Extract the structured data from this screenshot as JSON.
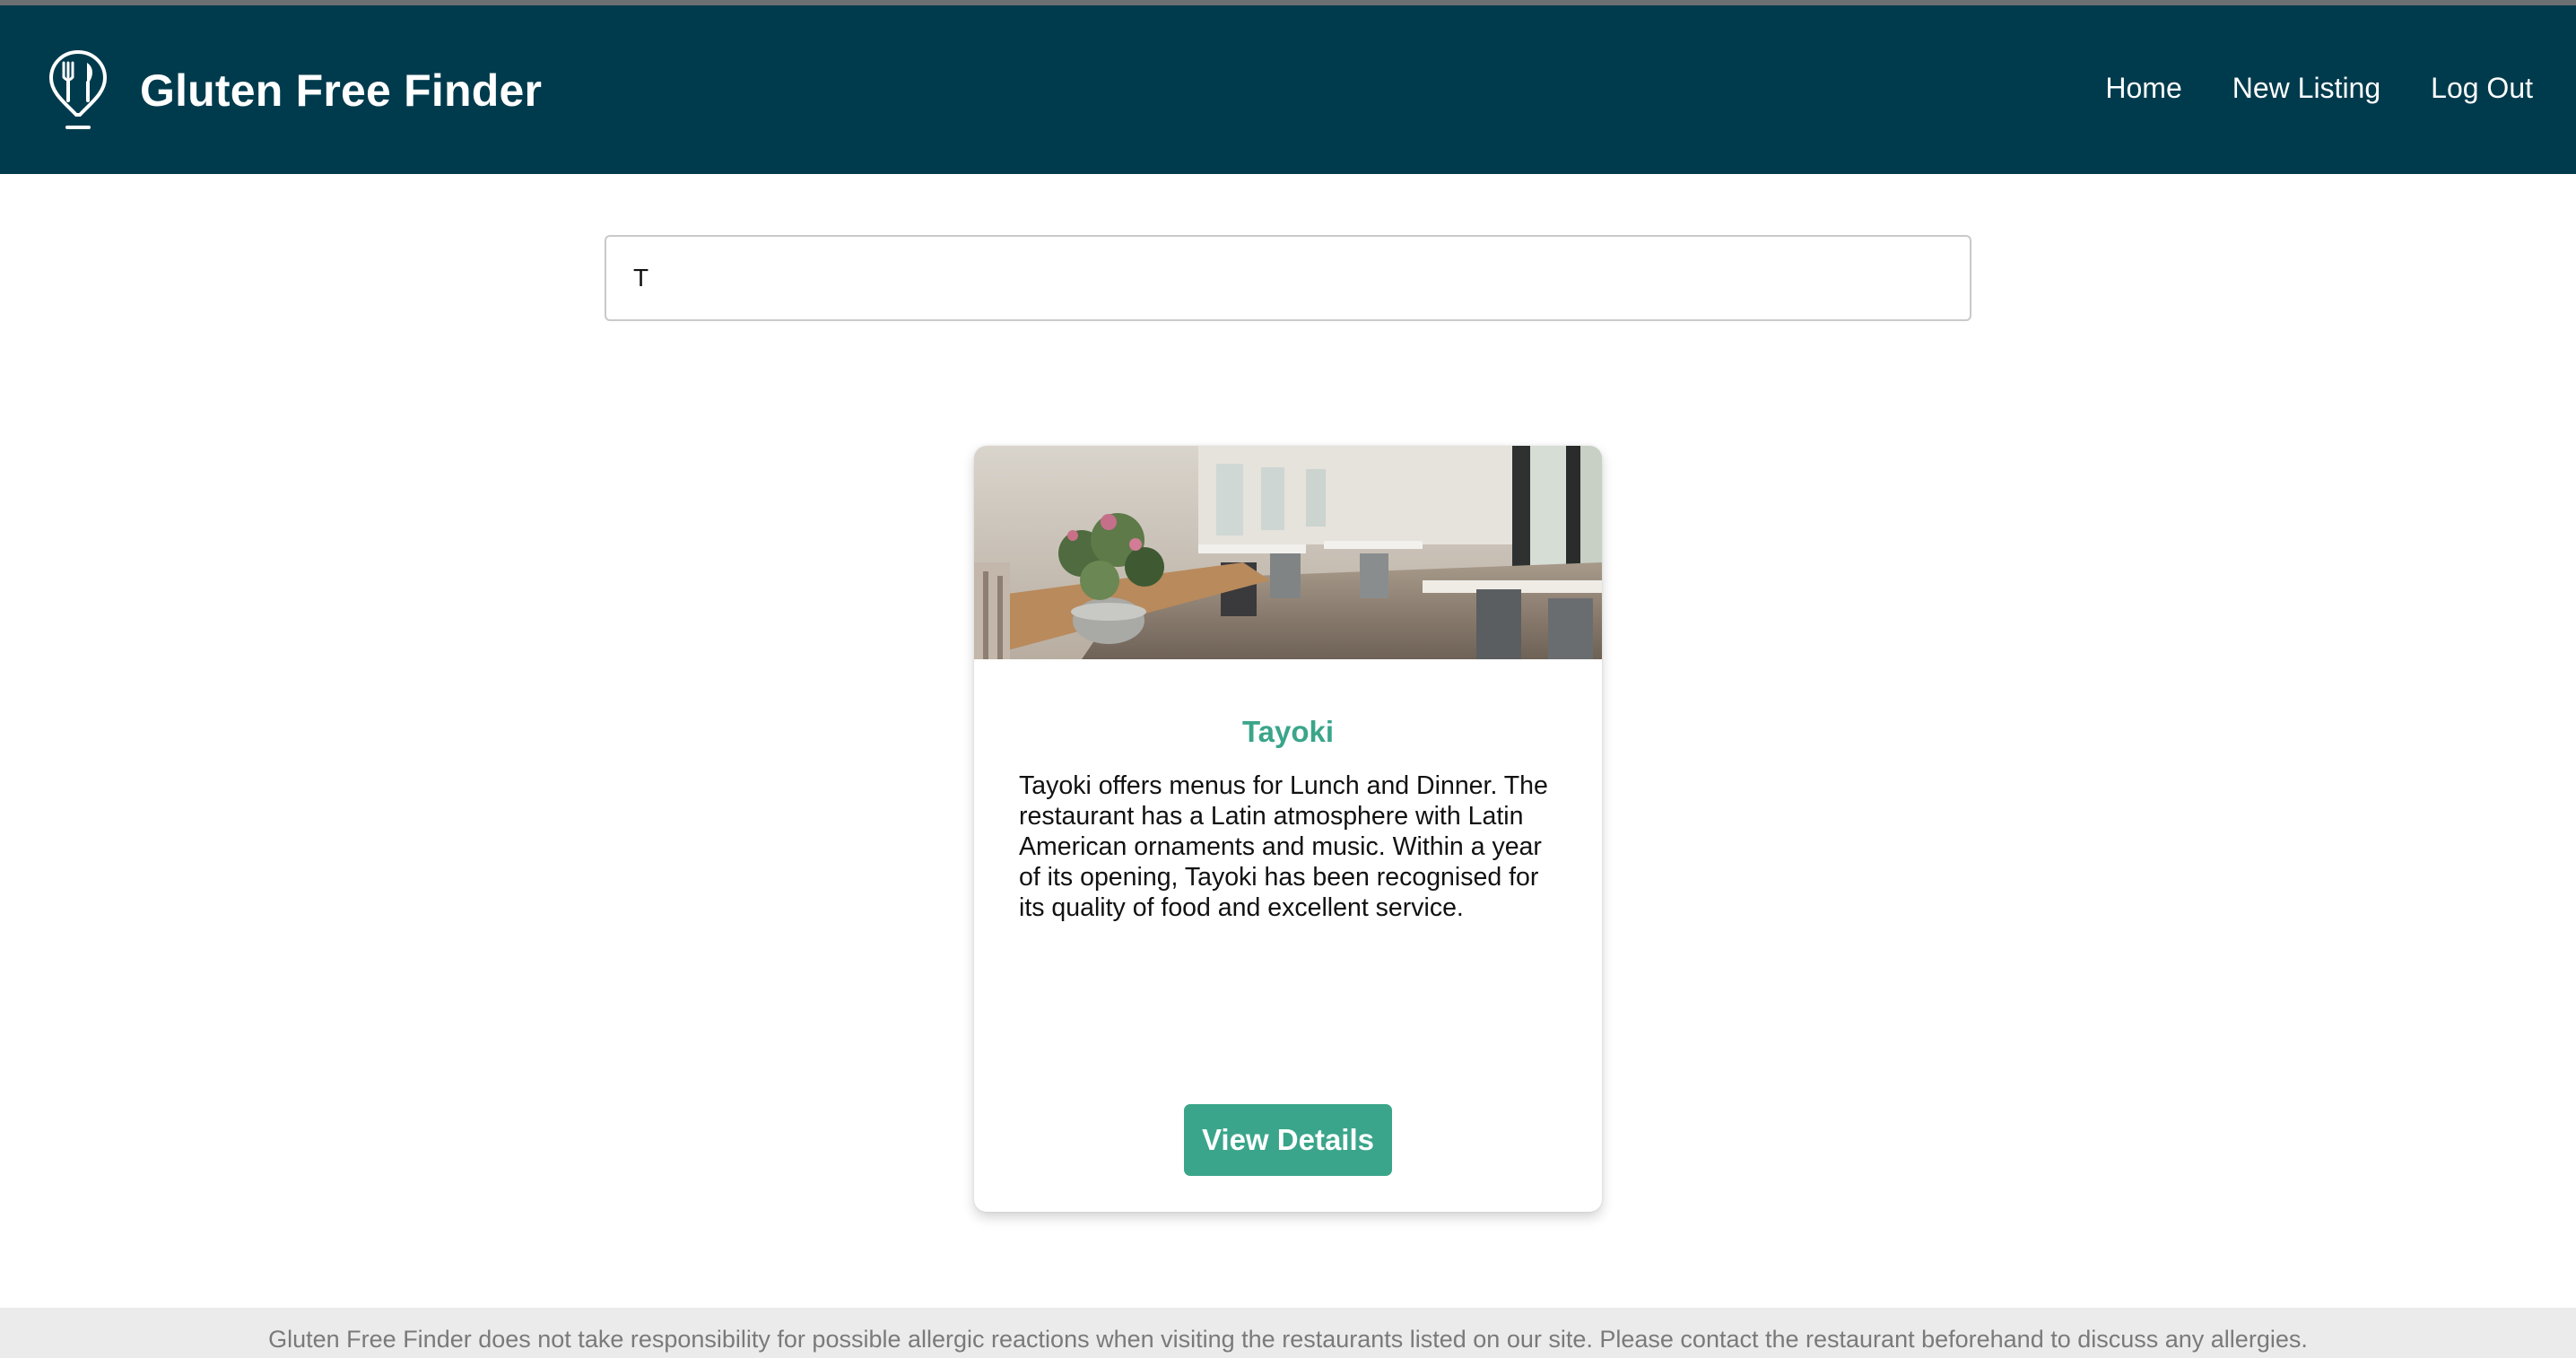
{
  "header": {
    "brand_title": "Gluten Free Finder",
    "logo_icon": "map-pin-fork-knife-icon",
    "nav": [
      {
        "label": "Home"
      },
      {
        "label": "New Listing"
      },
      {
        "label": "Log Out"
      }
    ]
  },
  "search": {
    "value": "T",
    "placeholder": ""
  },
  "results": [
    {
      "name": "Tayoki",
      "image": "restaurant-interior-photo",
      "description": "Tayoki offers menus for Lunch and Dinner. The restaurant has a Latin atmosphere with Latin American ornaments and music. Within a year of its opening, Tayoki has been recognised for its quality of food and excellent service.",
      "button_label": "View Details"
    }
  ],
  "footer": {
    "disclaimer": "Gluten Free Finder does not take responsibility for possible allergic reactions when visiting the restaurants listed on our site. Please contact the restaurant beforehand to discuss any allergies."
  },
  "colors": {
    "navbar": "#003b4d",
    "accent": "#3aa58a",
    "footer_bg": "#ebebeb"
  }
}
